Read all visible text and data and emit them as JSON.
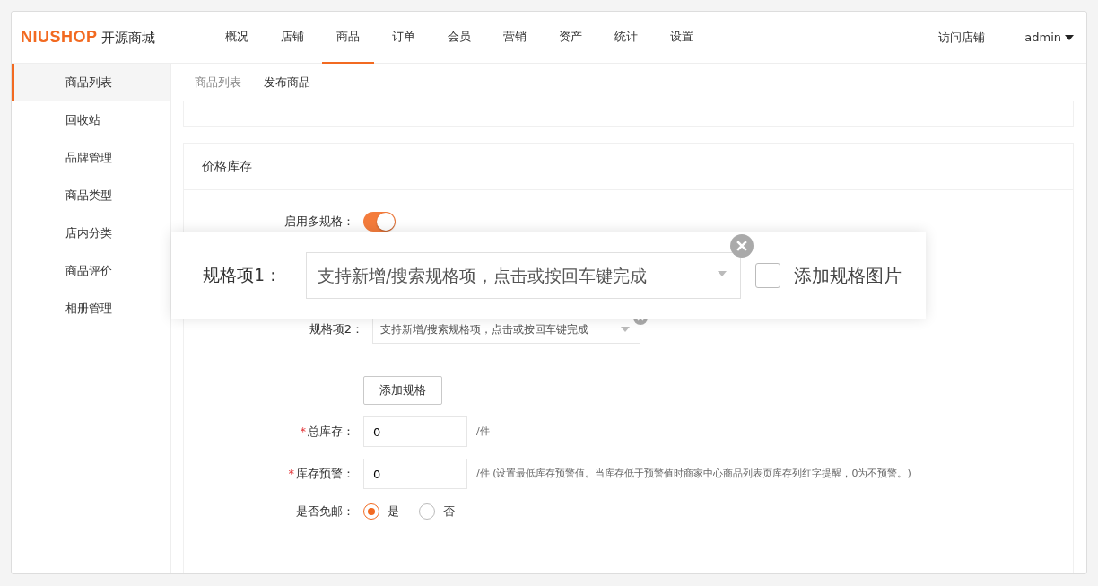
{
  "logo": {
    "brand": "NIUSHOP",
    "subtitle": "开源商城"
  },
  "nav": [
    {
      "label": "概况",
      "selected": false
    },
    {
      "label": "店铺",
      "selected": false
    },
    {
      "label": "商品",
      "selected": true
    },
    {
      "label": "订单",
      "selected": false
    },
    {
      "label": "会员",
      "selected": false
    },
    {
      "label": "营销",
      "selected": false
    },
    {
      "label": "资产",
      "selected": false
    },
    {
      "label": "统计",
      "selected": false
    },
    {
      "label": "设置",
      "selected": false
    }
  ],
  "header_right": {
    "visit_store": "访问店铺",
    "user": "admin"
  },
  "sidebar": {
    "items": [
      {
        "label": "商品列表",
        "selected": true
      },
      {
        "label": "回收站",
        "selected": false
      },
      {
        "label": "品牌管理",
        "selected": false
      },
      {
        "label": "商品类型",
        "selected": false
      },
      {
        "label": "店内分类",
        "selected": false
      },
      {
        "label": "商品评价",
        "selected": false
      },
      {
        "label": "相册管理",
        "selected": false
      }
    ]
  },
  "breadcrumb": {
    "parent": "商品列表",
    "separator": "-",
    "current": "发布商品"
  },
  "section_title": "价格库存",
  "multi_spec": {
    "label": "启用多规格：",
    "on": true
  },
  "spec_overlay": {
    "label": "规格项1：",
    "placeholder": "支持新增/搜索规格项，点击或按回车键完成",
    "add_image_label": "添加规格图片",
    "checked": false
  },
  "spec_items": [
    {
      "label": "规格项2：",
      "placeholder": "支持新增/搜索规格项，点击或按回车键完成"
    }
  ],
  "add_spec_button": "添加规格",
  "fields": [
    {
      "label": "总库存：",
      "required_mark": "*",
      "value": "0",
      "hint": "/件"
    },
    {
      "label": "库存预警：",
      "required_mark": "*",
      "value": "0",
      "hint": "/件 (设置最低库存预警值。当库存低于预警值时商家中心商品列表页库存列红字提醒，0为不预警。)"
    }
  ],
  "free_shipping": {
    "label": "是否免邮：",
    "options": [
      {
        "label": "是",
        "selected": true
      },
      {
        "label": "否",
        "selected": false
      }
    ]
  }
}
